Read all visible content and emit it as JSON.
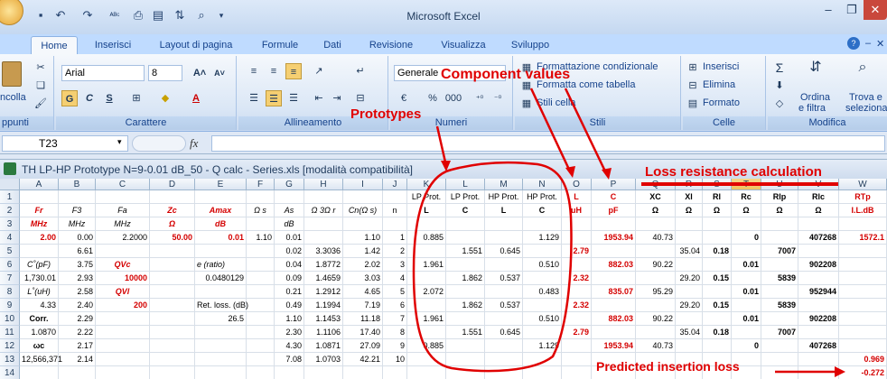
{
  "app": {
    "title": "Microsoft Excel"
  },
  "tabs": [
    "Home",
    "Inserisci",
    "Layout di pagina",
    "Formule",
    "Dati",
    "Revisione",
    "Visualizza",
    "Sviluppo"
  ],
  "ribbon": {
    "clipboard": {
      "paste_label": "ncolla",
      "group_label": "ppunti"
    },
    "font": {
      "name": "Arial",
      "size": "8",
      "bold": "G",
      "italic": "C",
      "underline": "S",
      "group_label": "Carattere"
    },
    "alignment": {
      "group_label": "Allineamento"
    },
    "number": {
      "format": "Generale",
      "percent": "%",
      "thousands": "000",
      "group_label": "Numeri"
    },
    "styles": {
      "cond_format": "Formattazione condizionale",
      "format_table": "Formatta come tabella",
      "cell_styles": "Stili cella",
      "group_label": "Stili"
    },
    "cells": {
      "insert": "Inserisci",
      "delete": "Elimina",
      "format": "Formato",
      "group_label": "Celle"
    },
    "editing": {
      "sort_filter_1": "Ordina",
      "sort_filter_2": "e filtra",
      "find_1": "Trova e",
      "find_2": "seleziona",
      "group_label": "Modifica"
    }
  },
  "formula_bar": {
    "name_box": "T23",
    "fx": "fx",
    "content": ""
  },
  "window": {
    "title": "TH LP-HP Prototype N=9-0.01 dB_50 - Q calc - Series.xls  [modalità compatibilità]"
  },
  "columns": [
    "A",
    "B",
    "C",
    "D",
    "E",
    "F",
    "G",
    "H",
    "I",
    "J",
    "K",
    "L",
    "M",
    "N",
    "O",
    "P",
    "Q",
    "R",
    "S",
    "T",
    "U",
    "V",
    "W"
  ],
  "rows": [
    "1",
    "2",
    "3",
    "4",
    "5",
    "6",
    "7",
    "8",
    "9",
    "10",
    "11",
    "12",
    "13",
    "14"
  ],
  "cells": {
    "r1": {
      "K": "LP Prot.",
      "L": "LP Prot.",
      "M": "HP Prot.",
      "N": "HP Prot.",
      "O": "L",
      "P": "C",
      "Q": "XC",
      "R": "Xl",
      "S": "Rl",
      "T": "Rc",
      "U": "Rlp",
      "V": "Rlc",
      "W": "RTp"
    },
    "r2": {
      "A": "Fr",
      "B": "F3",
      "C": "Fa",
      "D": "Zc",
      "E": "Amax",
      "F": "Ω s",
      "G": "As",
      "H": "Ω 3Ω r",
      "I": "Cn(Ω s)",
      "J": "n",
      "K": "L",
      "L": "C",
      "M": "L",
      "N": "C",
      "O": "uH",
      "P": "pF",
      "Q": "Ω",
      "R": "Ω",
      "S": "Ω",
      "T": "Ω",
      "U": "Ω",
      "V": "Ω",
      "W": "I.L.dB"
    },
    "r3": {
      "A": "MHz",
      "B": "MHz",
      "C": "MHz",
      "D": "Ω",
      "E": "dB",
      "G": "dB"
    },
    "r4": {
      "A": "2.00",
      "B": "0.00",
      "C": "2.2000",
      "D": "50.00",
      "E": "0.01",
      "F": "1.10",
      "G": "0.01",
      "I": "1.10",
      "J": "1",
      "K": "0.885",
      "N": "1.129",
      "P": "1953.94",
      "Q": "40.73",
      "T": "0",
      "V": "407268",
      "W": "1572.1"
    },
    "r5": {
      "B": "6.61",
      "G": "0.02",
      "H": "3.3036",
      "I": "1.42",
      "J": "2",
      "L": "1.551",
      "M": "0.645",
      "O": "2.79",
      "R": "35.04",
      "S": "0.18",
      "U": "7007"
    },
    "r6": {
      "A": "C˚(pF)",
      "B": "3.75",
      "C": "QVc",
      "E": "e (ratio)",
      "G": "0.04",
      "H": "1.8772",
      "I": "2.02",
      "J": "3",
      "K": "1.961",
      "N": "0.510",
      "P": "882.03",
      "Q": "90.22",
      "T": "0.01",
      "V": "902208"
    },
    "r7": {
      "A": "1,730.01",
      "B": "2.93",
      "C": "10000",
      "E": "0.0480129",
      "G": "0.09",
      "H": "1.4659",
      "I": "3.03",
      "J": "4",
      "L": "1.862",
      "M": "0.537",
      "O": "2.32",
      "R": "29.20",
      "S": "0.15",
      "U": "5839"
    },
    "r8": {
      "A": "L˚(uH)",
      "B": "2.58",
      "C": "QVl",
      "G": "0.21",
      "H": "1.2912",
      "I": "4.65",
      "J": "5",
      "K": "2.072",
      "N": "0.483",
      "P": "835.07",
      "Q": "95.29",
      "T": "0.01",
      "V": "952944"
    },
    "r9": {
      "A": "4.33",
      "B": "2.40",
      "C": "200",
      "E": "Ret. loss. (dB)",
      "G": "0.49",
      "H": "1.1994",
      "I": "7.19",
      "J": "6",
      "L": "1.862",
      "M": "0.537",
      "O": "2.32",
      "R": "29.20",
      "S": "0.15",
      "U": "5839"
    },
    "r10": {
      "A": "Corr.",
      "B": "2.29",
      "E": "26.5",
      "G": "1.10",
      "H": "1.1453",
      "I": "11.18",
      "J": "7",
      "K": "1.961",
      "N": "0.510",
      "P": "882.03",
      "Q": "90.22",
      "T": "0.01",
      "V": "902208"
    },
    "r11": {
      "A": "1.0870",
      "B": "2.22",
      "G": "2.30",
      "H": "1.1106",
      "I": "17.40",
      "J": "8",
      "L": "1.551",
      "M": "0.645",
      "O": "2.79",
      "R": "35.04",
      "S": "0.18",
      "U": "7007"
    },
    "r12": {
      "A": "ωc",
      "B": "2.17",
      "G": "4.30",
      "H": "1.0871",
      "I": "27.09",
      "J": "9",
      "K": "0.885",
      "N": "1.129",
      "P": "1953.94",
      "Q": "40.73",
      "T": "0",
      "V": "407268"
    },
    "r13": {
      "A": "12,566,371",
      "B": "2.14",
      "G": "7.08",
      "H": "1.0703",
      "I": "42.21",
      "J": "10",
      "W": "0.969"
    },
    "r14": {
      "W": "-0.272"
    }
  },
  "annotations": {
    "component_values": "Component values",
    "prototypes": "Prototypes",
    "loss_resistance": "Loss resistance calculation",
    "insertion_loss": "Predicted insertion loss"
  },
  "colors": {
    "annotation": "#e00000",
    "ribbon_bg": "#dbe7f6",
    "accent": "#15428b"
  }
}
